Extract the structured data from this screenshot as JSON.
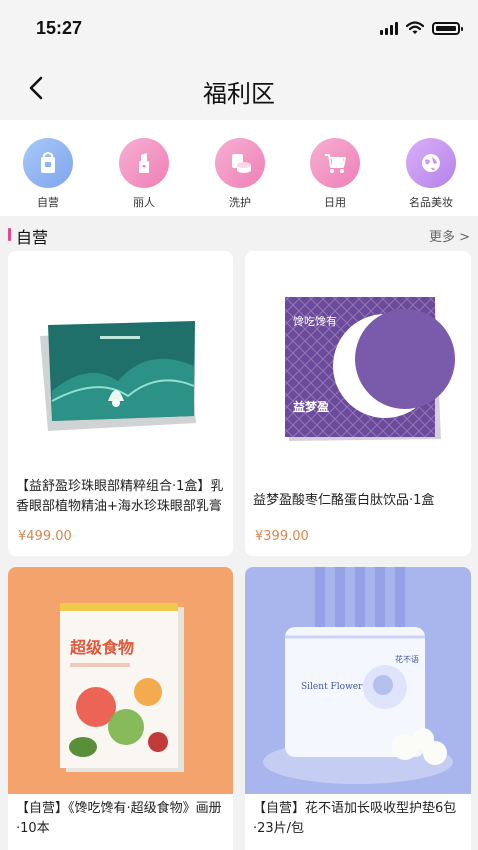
{
  "status_bar": {
    "time": "15:27"
  },
  "header": {
    "title": "福利区"
  },
  "categories": [
    {
      "label": "自营",
      "icon": "shopping-bag-icon",
      "color": "#8fb4f2"
    },
    {
      "label": "丽人",
      "icon": "lipstick-icon",
      "color": "#f28bc0"
    },
    {
      "label": "洗护",
      "icon": "cream-jar-icon",
      "color": "#f28bc0"
    },
    {
      "label": "日用",
      "icon": "shopping-cart-icon",
      "color": "#f28bc0"
    },
    {
      "label": "名品美妆",
      "icon": "globe-icon",
      "color": "#c88ef0"
    }
  ],
  "section": {
    "title": "自营",
    "more": "更多 >"
  },
  "products": [
    {
      "name": "【益舒盈珍珠眼部精粹组合·1盒】乳香眼部植物精油+海水珍珠眼部乳膏",
      "price": "¥499.00"
    },
    {
      "name": "益梦盈酸枣仁酪蛋白肽饮品·1盒",
      "price": "¥399.00",
      "brand": "馋吃馋有",
      "box_label": "益梦盈"
    },
    {
      "name": "【自营】《馋吃馋有·超级食物》画册·10本",
      "price": "",
      "book_title": "超级食物"
    },
    {
      "name": "【自营】花不语加长吸收型护垫6包·23片/包",
      "price": "",
      "pack_brand": "Silent Flower",
      "pack_logo": "花不语"
    }
  ]
}
